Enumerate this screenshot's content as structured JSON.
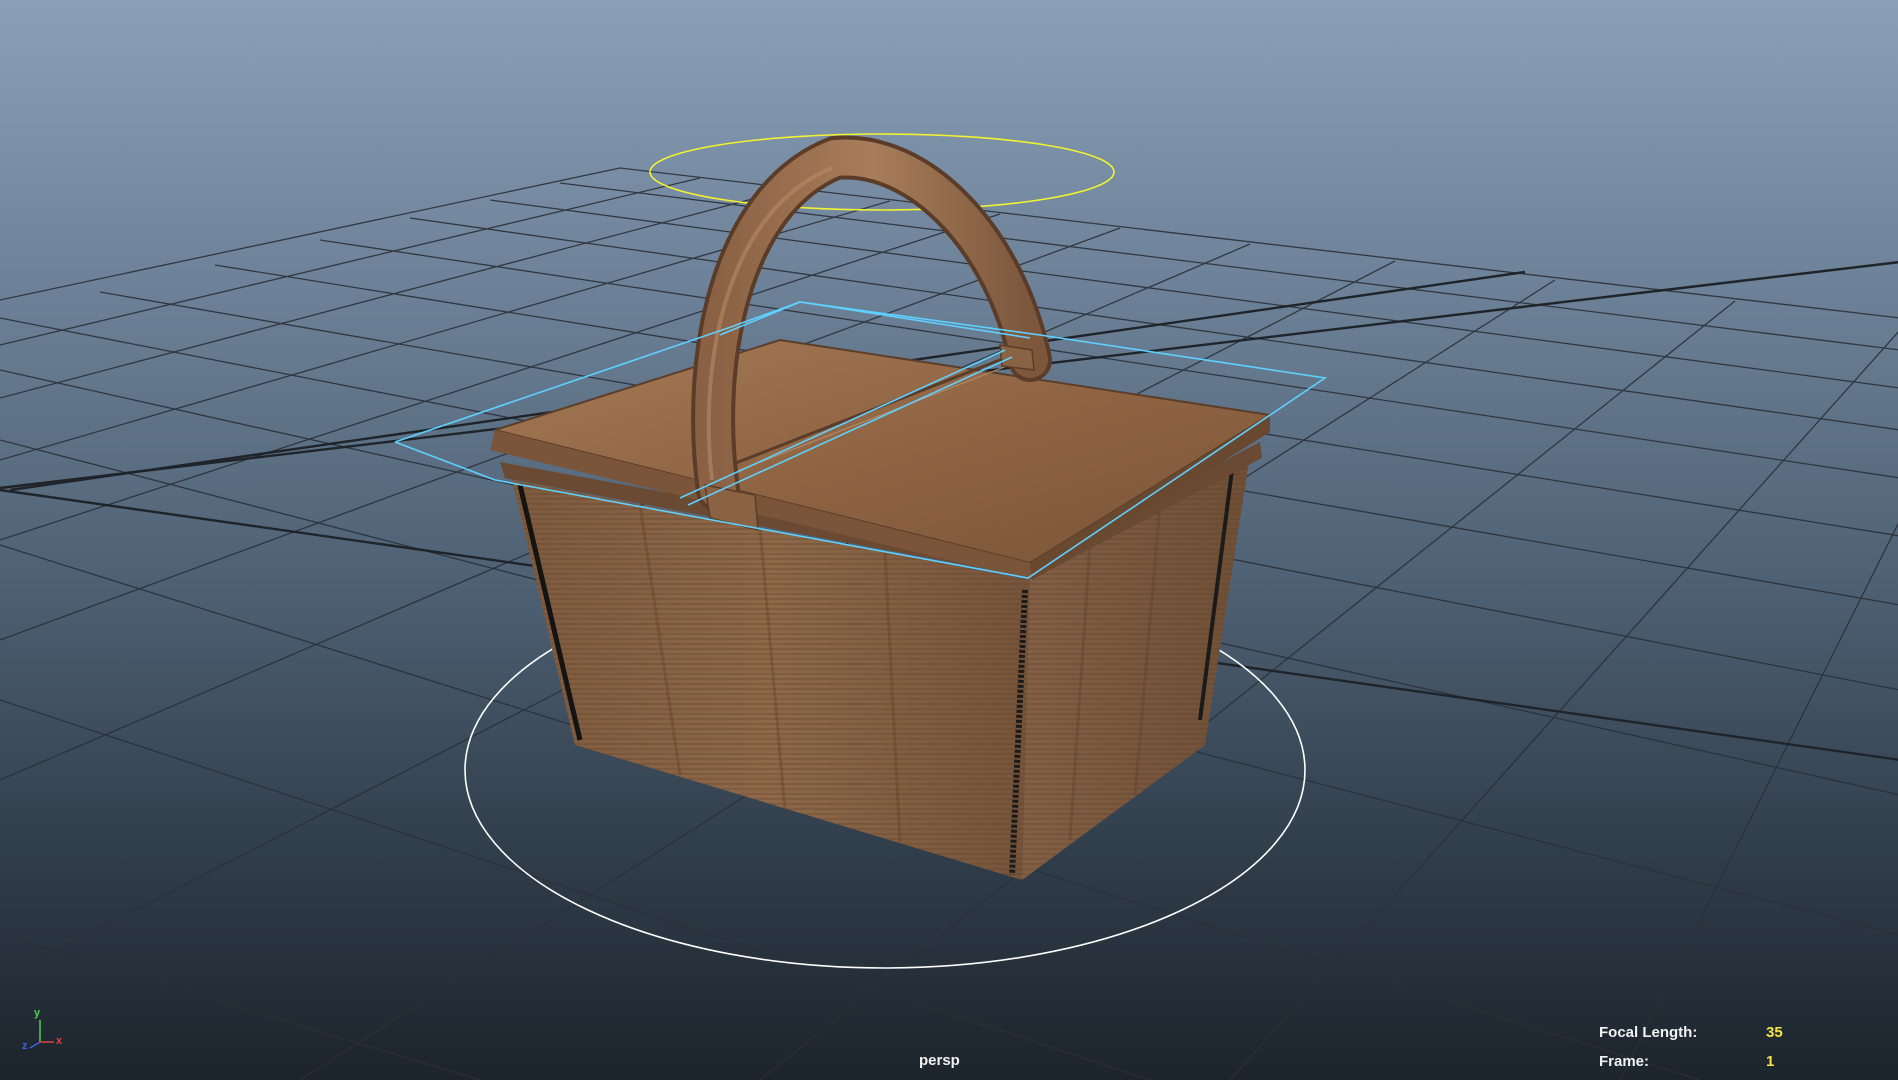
{
  "viewport": {
    "camera": "persp",
    "background_top": "#8aa0b8",
    "background_bottom": "#1c242c"
  },
  "hud": {
    "focal_length_label": "Focal Length:",
    "focal_length_value": "35",
    "frame_label": "Frame:",
    "frame_value": "1"
  },
  "axis": {
    "y_label": "y",
    "x_label": "x",
    "z_label": "z"
  },
  "colors": {
    "hud_label": "#f2f2f2",
    "hud_value": "#f5e642",
    "selection_highlight": "#5fd0ff",
    "manipulator_ring": "#ffffff",
    "handle_ring": "#f2f230",
    "basket_wood": "#9a6e4c",
    "grid_line": "#2a2f36"
  }
}
